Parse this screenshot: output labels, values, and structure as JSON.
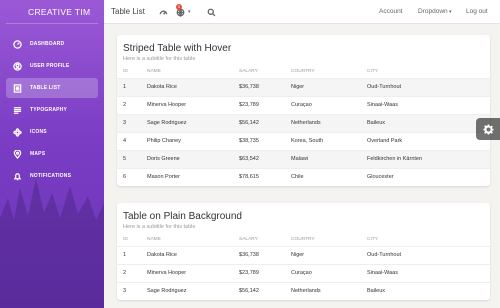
{
  "brand": "CREATIVE TIM",
  "sidebar": {
    "items": [
      {
        "label": "DASHBOARD",
        "icon": "dashboard-icon",
        "active": false
      },
      {
        "label": "USER PROFILE",
        "icon": "user-icon",
        "active": false
      },
      {
        "label": "TABLE LIST",
        "icon": "list-icon",
        "active": true
      },
      {
        "label": "TYPOGRAPHY",
        "icon": "typography-icon",
        "active": false
      },
      {
        "label": "ICONS",
        "icon": "atom-icon",
        "active": false
      },
      {
        "label": "MAPS",
        "icon": "map-pin-icon",
        "active": false
      },
      {
        "label": "NOTIFICATIONS",
        "icon": "bell-icon",
        "active": false
      }
    ]
  },
  "navbar": {
    "title": "Table List",
    "notification_count": "5",
    "account": "Account",
    "dropdown": "Dropdown",
    "logout": "Log out"
  },
  "tables": [
    {
      "title": "Striped Table with Hover",
      "subtitle": "Here is a subtitle for this table",
      "columns": [
        "ID",
        "NAME",
        "SALARY",
        "COUNTRY",
        "CITY"
      ],
      "rows": [
        [
          "1",
          "Dakota Rice",
          "$36,738",
          "Niger",
          "Oud-Turnhout"
        ],
        [
          "2",
          "Minerva Hooper",
          "$23,789",
          "Curaçao",
          "Sinaai-Waas"
        ],
        [
          "3",
          "Sage Rodriguez",
          "$56,142",
          "Netherlands",
          "Baileux"
        ],
        [
          "4",
          "Philip Chaney",
          "$38,735",
          "Korea, South",
          "Overland Park"
        ],
        [
          "5",
          "Doris Greene",
          "$63,542",
          "Malawi",
          "Feldkirchen in Kärnten"
        ],
        [
          "6",
          "Mason Porter",
          "$78,615",
          "Chile",
          "Gloucester"
        ]
      ]
    },
    {
      "title": "Table on Plain Background",
      "subtitle": "Here is a subtitle for this table",
      "columns": [
        "ID",
        "NAME",
        "SALARY",
        "COUNTRY",
        "CITY"
      ],
      "rows": [
        [
          "1",
          "Dakota Rice",
          "$36,738",
          "Niger",
          "Oud-Turnhout"
        ],
        [
          "2",
          "Minerva Hooper",
          "$23,789",
          "Curaçao",
          "Sinaai-Waas"
        ],
        [
          "3",
          "Sage Rodriguez",
          "$56,142",
          "Netherlands",
          "Baileux"
        ]
      ]
    }
  ],
  "colors": {
    "sidebar_top": "#9b59d6",
    "sidebar_bottom": "#6a34b6",
    "badge": "#e84c3d"
  }
}
